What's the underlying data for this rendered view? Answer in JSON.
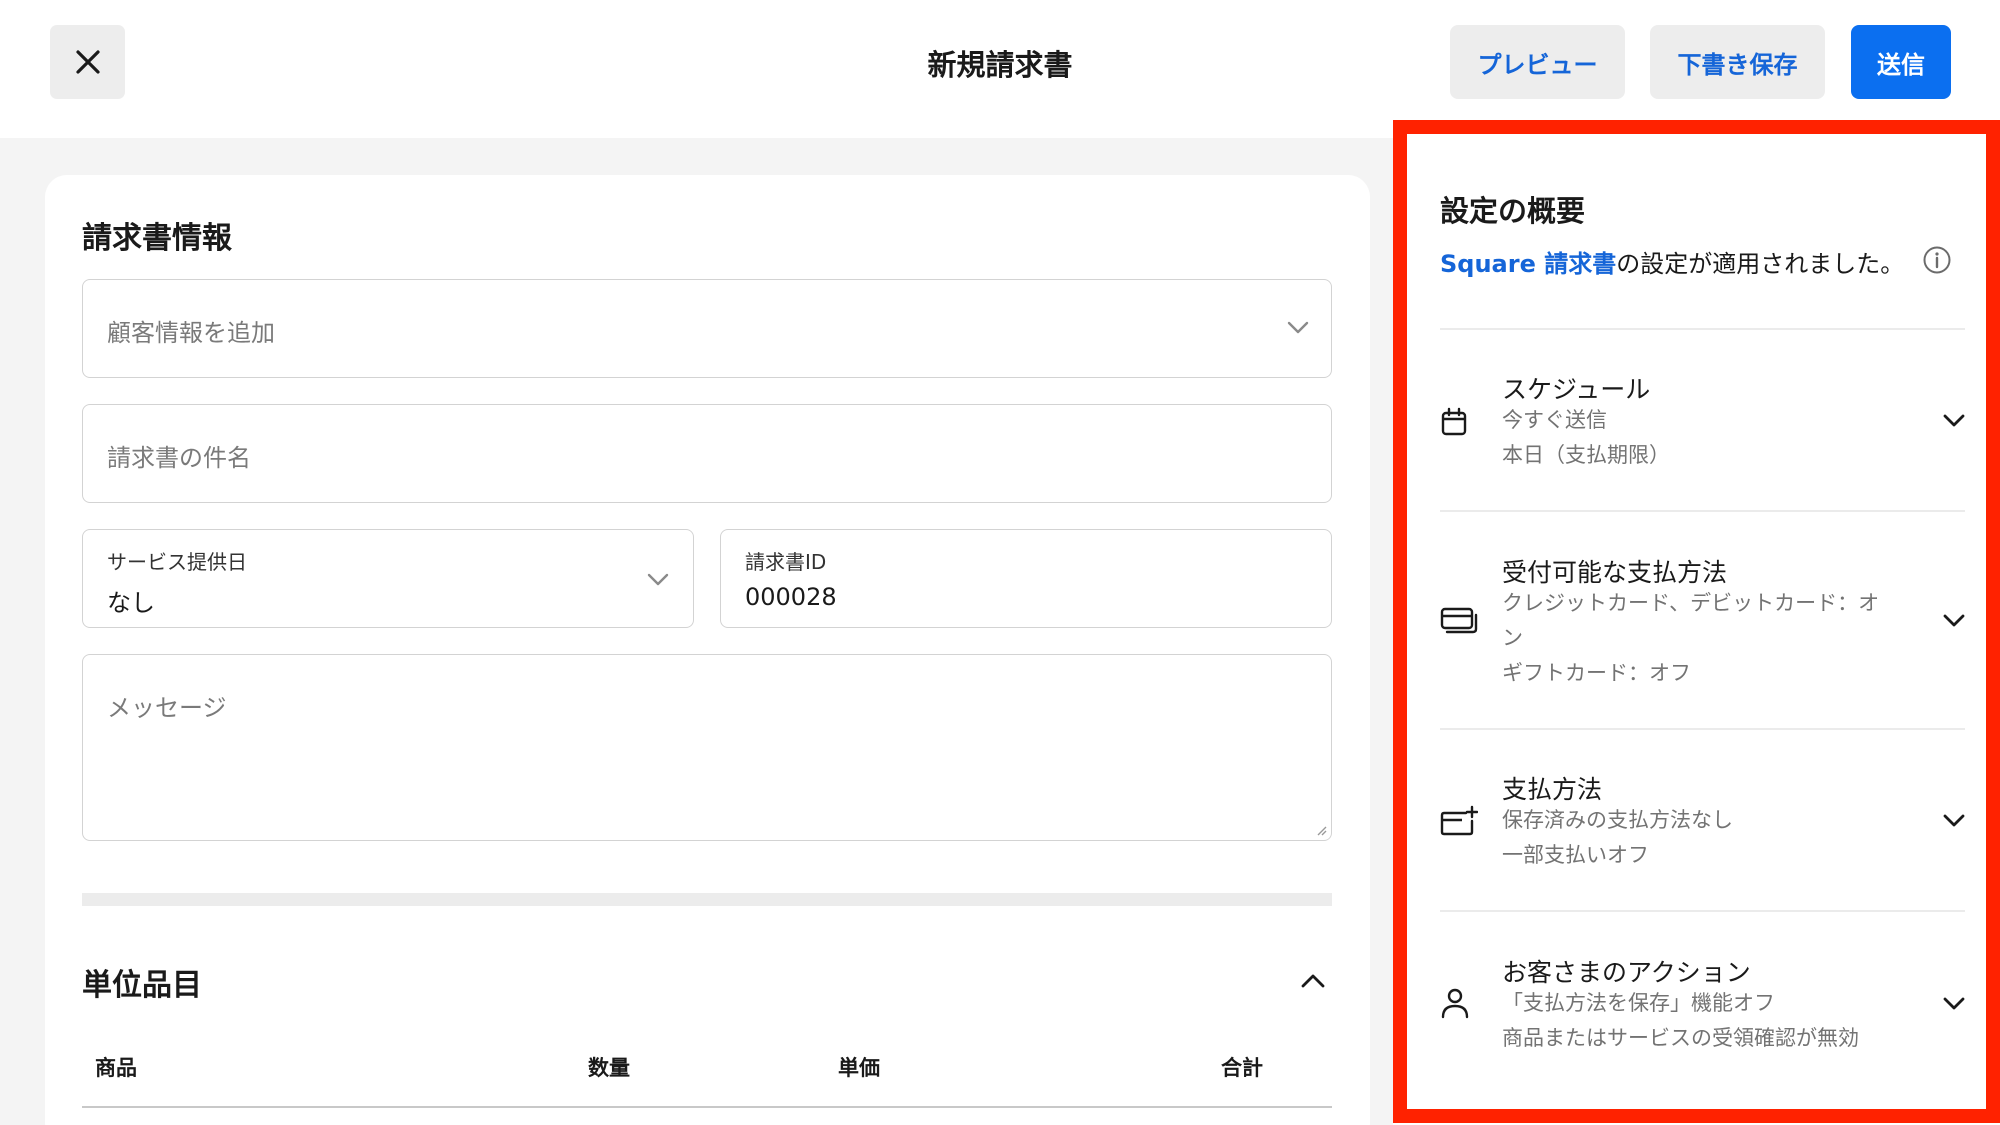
{
  "header": {
    "title": "新規請求書",
    "preview_label": "プレビュー",
    "draft_label": "下書き保存",
    "send_label": "送信"
  },
  "invoice_info": {
    "section_title": "請求書情報",
    "customer_placeholder": "顧客情報を追加",
    "subject_placeholder": "請求書の件名",
    "service_date_label": "サービス提供日",
    "service_date_value": "なし",
    "invoice_id_label": "請求書ID",
    "invoice_id_value": "000028",
    "message_placeholder": "メッセージ"
  },
  "line_items": {
    "section_title": "単位品目",
    "columns": [
      "商品",
      "数量",
      "単価",
      "合計"
    ]
  },
  "settings_summary": {
    "title": "設定の概要",
    "subtitle_link": "Square 請求書",
    "subtitle_rest": "の設定が適用されました。",
    "items": [
      {
        "title": "スケジュール",
        "lines": [
          "今すぐ送信",
          "本日（支払期限）"
        ]
      },
      {
        "title": "受付可能な支払方法",
        "lines": [
          "クレジットカード、デビットカード：オン",
          "ギフトカード：オフ"
        ]
      },
      {
        "title": "支払方法",
        "lines": [
          "保存済みの支払方法なし",
          "一部支払いオフ"
        ]
      },
      {
        "title": "お客さまのアクション",
        "lines": [
          "「支払方法を保存」機能オフ",
          "商品またはサービスの受領確認が無効"
        ]
      }
    ]
  },
  "colors": {
    "accent_blue": "#0b6ff0",
    "link_blue": "#1565d8",
    "highlight_red": "#ff2200"
  }
}
